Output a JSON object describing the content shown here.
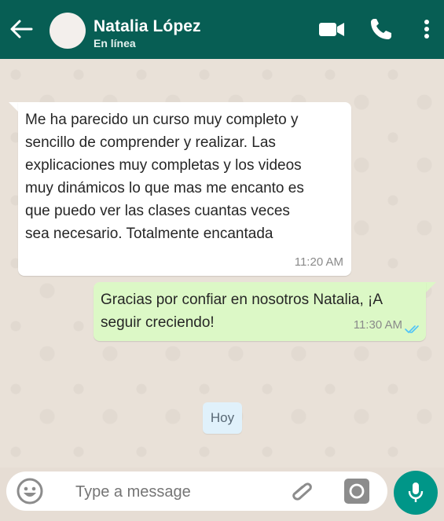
{
  "header": {
    "contact_name": "Natalia López",
    "status": "En línea"
  },
  "messages": [
    {
      "direction": "incoming",
      "lines": [
        "Me ha parecido un curso muy completo y",
        "sencillo de comprender y realizar. Las",
        "explicaciones muy completas y los videos",
        "muy dinámicos lo que mas me encanto es",
        "que puedo ver las clases cuantas veces",
        "sea necesario. Totalmente encantada"
      ],
      "time": "11:20 AM"
    },
    {
      "direction": "outgoing",
      "lines": [
        "Gracias por confiar en nosotros Natalia, ¡A",
        "seguir creciendo!"
      ],
      "time": "11:30 AM",
      "status": "read"
    }
  ],
  "date_chip": "Hoy",
  "composer": {
    "placeholder": "Type a message"
  },
  "colors": {
    "header": "#075e54",
    "incoming_bubble": "#ffffff",
    "outgoing_bubble": "#dcf8c6",
    "read_ticks": "#4fc3f7",
    "mic_button": "#009688"
  },
  "icons": [
    "back-arrow-icon",
    "video-call-icon",
    "phone-icon",
    "more-vert-icon",
    "emoji-icon",
    "attach-icon",
    "camera-icon",
    "mic-icon"
  ]
}
